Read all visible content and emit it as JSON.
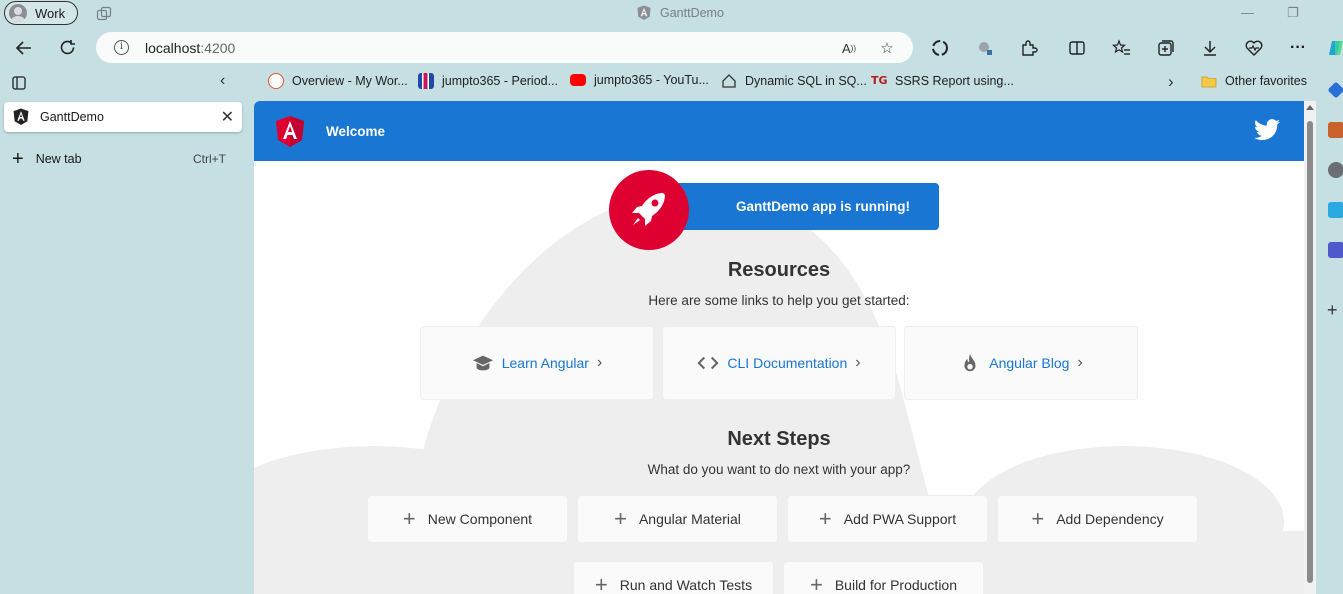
{
  "browser": {
    "profile_label": "Work",
    "window_title": "GanttDemo",
    "address": {
      "host": "localhost",
      "port": ":4200"
    },
    "bookmarks": [
      {
        "label": "Overview - My Wor...",
        "icon": "azure-devops-icon"
      },
      {
        "label": "jumpto365 - Period...",
        "icon": "periodic-table-icon"
      },
      {
        "label": "jumpto365 - YouTu...",
        "icon": "youtube-icon"
      },
      {
        "label": "Dynamic SQL in SQ...",
        "icon": "house-icon"
      },
      {
        "label": "SSRS Report using...",
        "icon": "tg-logo-icon"
      }
    ],
    "other_favorites_label": "Other favorites",
    "vertical_tabs": [
      {
        "title": "GanttDemo",
        "icon": "angular-icon",
        "active": true
      }
    ],
    "new_tab_label": "New tab",
    "new_tab_shortcut": "Ctrl+T"
  },
  "app": {
    "header_title": "Welcome",
    "running_text": "GanttDemo app is running!",
    "resources_title": "Resources",
    "resources_subtitle": "Here are some links to help you get started:",
    "resources": [
      {
        "label": "Learn Angular",
        "icon": "graduation-cap-icon"
      },
      {
        "label": "CLI Documentation",
        "icon": "code-brackets-icon"
      },
      {
        "label": "Angular Blog",
        "icon": "flame-icon"
      }
    ],
    "next_title": "Next Steps",
    "next_subtitle": "What do you want to do next with your app?",
    "next_steps": [
      {
        "label": "New Component"
      },
      {
        "label": "Angular Material"
      },
      {
        "label": "Add PWA Support"
      },
      {
        "label": "Add Dependency"
      },
      {
        "label": "Run and Watch Tests"
      },
      {
        "label": "Build for Production"
      }
    ]
  },
  "colors": {
    "angular_red": "#dd0031",
    "primary_blue": "#1976d2",
    "browser_chrome": "#c5dfe2"
  }
}
